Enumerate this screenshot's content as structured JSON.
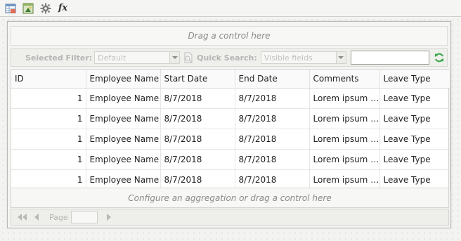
{
  "toolbar": {
    "icons": [
      "grid-settings-icon",
      "image-grid-icon",
      "gear-icon",
      "fx-icon"
    ],
    "fx_label": "fx"
  },
  "grid": {
    "top_dropzone": "Drag a control here",
    "bottom_dropzone": "Configure an aggregation or drag a control here",
    "filter": {
      "selected_filter_label": "Selected Filter:",
      "selected_filter_value": "Default",
      "quick_search_label": "Quick Search:",
      "quick_search_value": "Visible fields",
      "search_text": ""
    },
    "columns": [
      "ID",
      "Employee Name",
      "Start Date",
      "End Date",
      "Comments",
      "Leave Type"
    ],
    "rows": [
      [
        "1",
        "Employee Name",
        "8/7/2018",
        "8/7/2018",
        "Lorem ipsum d...",
        "Leave Type"
      ],
      [
        "1",
        "Employee Name",
        "8/7/2018",
        "8/7/2018",
        "Lorem ipsum d...",
        "Leave Type"
      ],
      [
        "1",
        "Employee Name",
        "8/7/2018",
        "8/7/2018",
        "Lorem ipsum d...",
        "Leave Type"
      ],
      [
        "1",
        "Employee Name",
        "8/7/2018",
        "8/7/2018",
        "Lorem ipsum d...",
        "Leave Type"
      ],
      [
        "1",
        "Employee Name",
        "8/7/2018",
        "8/7/2018",
        "Lorem ipsum d...",
        "Leave Type"
      ]
    ],
    "pager": {
      "page_label": "Page",
      "page_value": ""
    }
  },
  "colors": {
    "refresh_green": "#3aa64a",
    "disabled_text": "#b5b5b5"
  }
}
